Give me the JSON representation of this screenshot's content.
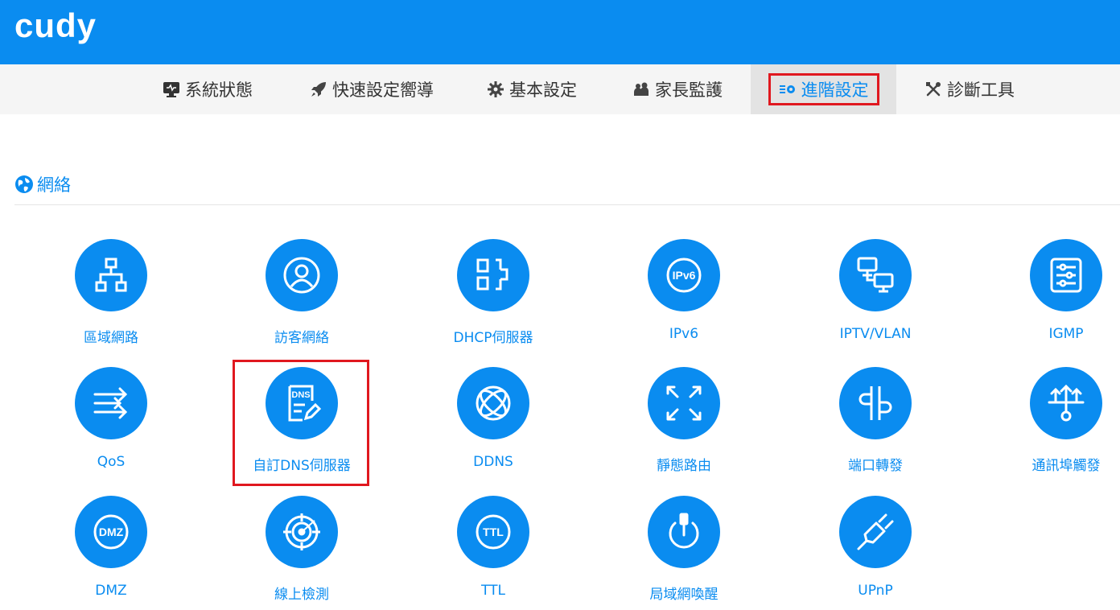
{
  "brand": {
    "logo": "cudy"
  },
  "nav": [
    {
      "label": "系統狀態",
      "icon": "monitor-icon"
    },
    {
      "label": "快速設定嚮導",
      "icon": "rocket-icon"
    },
    {
      "label": "基本設定",
      "icon": "gear-icon"
    },
    {
      "label": "家長監護",
      "icon": "users-icon"
    },
    {
      "label": "進階設定",
      "icon": "advanced-settings-icon",
      "active": true
    },
    {
      "label": "診斷工具",
      "icon": "tools-icon"
    }
  ],
  "section": {
    "title": "網絡",
    "icon": "globe-icon"
  },
  "tiles": [
    {
      "label": "區域網路",
      "icon": "lan-icon"
    },
    {
      "label": "訪客網絡",
      "icon": "guest-icon"
    },
    {
      "label": "DHCP伺服器",
      "icon": "dhcp-icon"
    },
    {
      "label": "IPv6",
      "icon": "ipv6-icon",
      "badge": "IPv6"
    },
    {
      "label": "IPTV/VLAN",
      "icon": "iptv-icon"
    },
    {
      "label": "IGMP",
      "icon": "igmp-icon"
    },
    {
      "label": "QoS",
      "icon": "qos-icon"
    },
    {
      "label": "自訂DNS伺服器",
      "icon": "dns-icon",
      "badge": "DNS",
      "highlighted": true
    },
    {
      "label": "DDNS",
      "icon": "ddns-icon"
    },
    {
      "label": "靜態路由",
      "icon": "static-route-icon"
    },
    {
      "label": "端口轉發",
      "icon": "port-forward-icon"
    },
    {
      "label": "通訊埠觸發",
      "icon": "port-trigger-icon"
    },
    {
      "label": "DMZ",
      "icon": "dmz-icon",
      "badge": "DMZ"
    },
    {
      "label": "線上檢測",
      "icon": "online-detect-icon"
    },
    {
      "label": "TTL",
      "icon": "ttl-icon",
      "badge": "TTL"
    },
    {
      "label": "局域網喚醒",
      "icon": "wol-icon"
    },
    {
      "label": "UPnP",
      "icon": "upnp-icon"
    }
  ],
  "colors": {
    "brand": "#0a8cf0",
    "highlight": "#e0181f",
    "nav_bg": "#f5f5f5"
  }
}
